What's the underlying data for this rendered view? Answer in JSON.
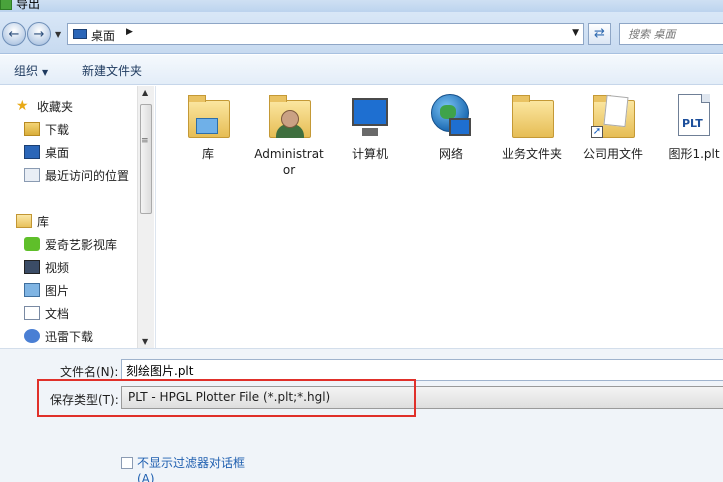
{
  "window": {
    "title": "导出"
  },
  "address": {
    "crumb": "桌面",
    "search_placeholder": "搜索 桌面"
  },
  "toolbar": {
    "organize": "组织",
    "new_folder": "新建文件夹"
  },
  "nav": {
    "favorites_label": "收藏夹",
    "favorites": [
      "下载",
      "桌面",
      "最近访问的位置"
    ],
    "libraries_label": "库",
    "libraries": [
      "爱奇艺影视库",
      "视频",
      "图片",
      "文档",
      "迅雷下载"
    ]
  },
  "files": [
    {
      "name": "库",
      "icon": "library-icon"
    },
    {
      "name": "Administrator",
      "icon": "user-folder-icon"
    },
    {
      "name": "计算机",
      "icon": "computer-icon"
    },
    {
      "name": "网络",
      "icon": "network-icon"
    },
    {
      "name": "业务文件夹",
      "icon": "folder-icon"
    },
    {
      "name": "公司用文件",
      "icon": "shortcut-folder-icon"
    },
    {
      "name": "图形1.plt",
      "icon": "plt-file-icon",
      "badge": "PLT"
    }
  ],
  "form": {
    "filename_label": "文件名(N):",
    "filename_value": "刻绘图片.plt",
    "filetype_label": "保存类型(T):",
    "filetype_value": "PLT - HPGL Plotter File (*.plt;*.hgl)",
    "hide_filter_label": "不显示过滤器对话框(A)"
  },
  "colors": {
    "highlight": "#e0302a",
    "link": "#1f5fb0"
  }
}
